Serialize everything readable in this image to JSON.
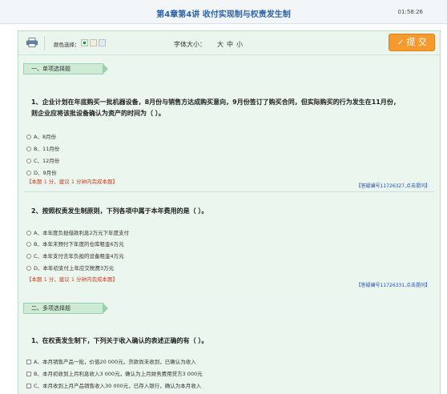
{
  "header": {
    "title": "第4章第4讲  收付实现制与权责发生制",
    "timer": "01:58:26"
  },
  "toolbar": {
    "color_label": "颜色选择：",
    "font_label": "字体大小：",
    "font_large": "大",
    "font_medium": "中",
    "font_small": "小",
    "submit_check": "✓",
    "submit_label": "提 交"
  },
  "sections": {
    "single": "一、单项选择题",
    "multi": "二、多项选择题"
  },
  "q1": {
    "line1": "1、企业计划在年底购买一批机器设备，8月份与销售方达成购买意向，9月份签订了购买合同，但实际购买的行为发生在11月份，",
    "line2": "则企业应将该批设备确认为资产的时间为（   ）。",
    "options": [
      "A、8月份",
      "B、11月份",
      "C、12月份",
      "D、9月份"
    ],
    "hint": "【本题 1 分，建议 1 分钟内完成本题】",
    "link": "【答疑编号11726327,点击提问】"
  },
  "q2": {
    "text": "2、按照权责发生制原则，下列各项中属于本年费用的是（   ）。",
    "options": [
      "A、本年度负担借款利息2万元下年度支付",
      "B、本年末预付下年度的仓库租金6万元",
      "C、本年支付去年负担的设备租金4万元",
      "D、本年初支付上年应交税费3万元"
    ],
    "hint": "【本题 1 分，建议 1 分钟内完成本题】",
    "link": "【答疑编号11726331,点击提问】"
  },
  "q3": {
    "text": "1、在权责发生制下，下列关于收入确认的表述正确的有（   ）。",
    "options": [
      "A、本月销售产品一批，价值20 000元，货款尚未收到，已确认为收入",
      "B、本月初收到上月利息收入3 000元，确认为上月财务费用贷方3 000元",
      "C、本月收到上月产品销售收入30 000元，已存入银行，确认为本月收入"
    ]
  },
  "colors": {
    "accent": "#f59a2f",
    "title": "#2b63a8",
    "panel": "#eaf6ef",
    "hint": "#d03a1c",
    "link": "#1f4fb5"
  }
}
